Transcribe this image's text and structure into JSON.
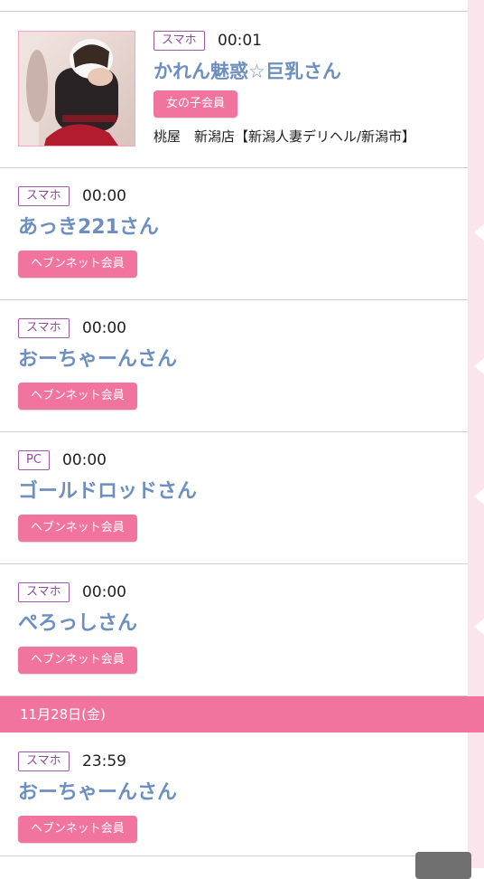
{
  "colors": {
    "accent_pink": "#f0749e",
    "rail_pink": "#fbe4ec",
    "device_tag_border": "#9b5aa6",
    "name_blue": "#6d8fc0"
  },
  "entries_top": [
    {
      "device": "スマホ",
      "time": "00:01",
      "name": "かれん魅惑☆巨乳さん",
      "badge": "女の子会員",
      "shop": "桃屋　新潟店【新潟人妻デリヘル/新潟市】",
      "photo_icon": "profile-photo"
    },
    {
      "device": "スマホ",
      "time": "00:00",
      "name": "あっき221さん",
      "badge": "ヘブンネット会員"
    },
    {
      "device": "スマホ",
      "time": "00:00",
      "name": "おーちゃーんさん",
      "badge": "ヘブンネット会員"
    },
    {
      "device": "PC",
      "time": "00:00",
      "name": "ゴールドロッドさん",
      "badge": "ヘブンネット会員"
    },
    {
      "device": "スマホ",
      "time": "00:00",
      "name": "ぺろっしさん",
      "badge": "ヘブンネット会員"
    }
  ],
  "date_header": "11月28日(金)",
  "entries_bottom": [
    {
      "device": "スマホ",
      "time": "23:59",
      "name": "おーちゃーんさん",
      "badge": "ヘブンネット会員"
    }
  ]
}
